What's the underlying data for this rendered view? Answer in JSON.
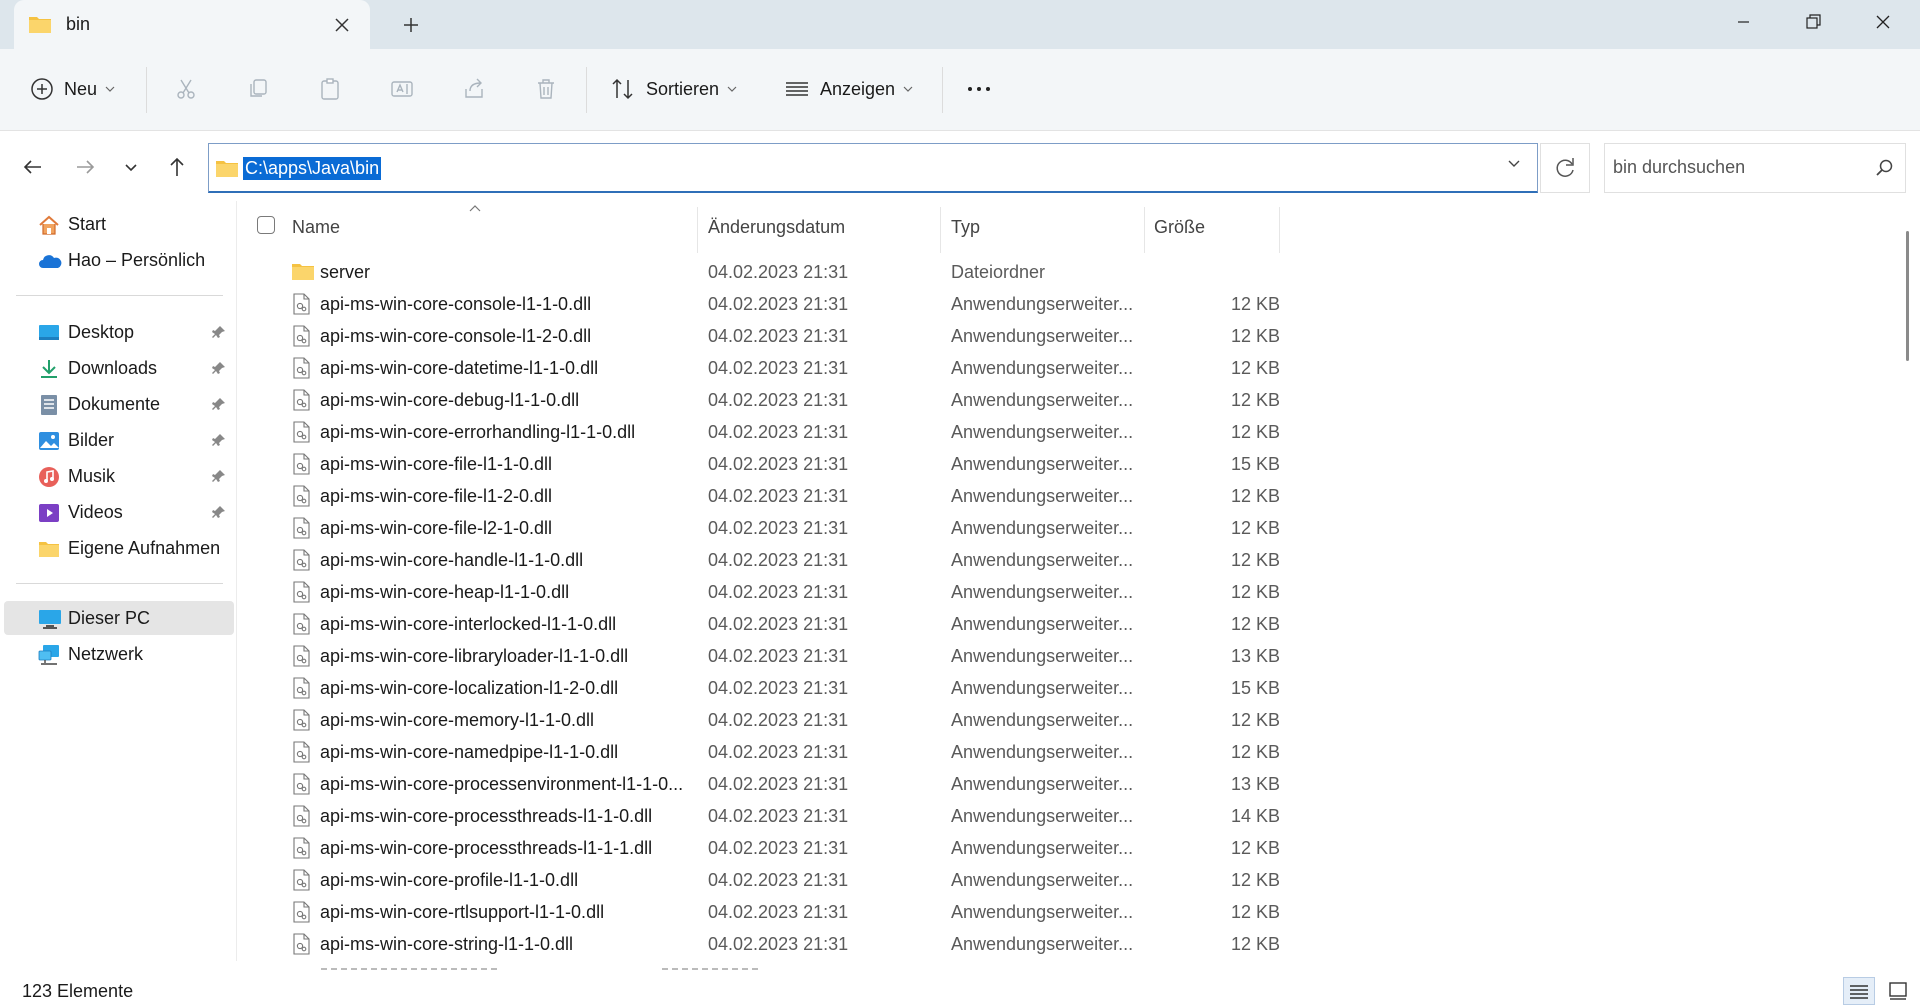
{
  "tab": {
    "title": "bin"
  },
  "toolbar": {
    "new_label": "Neu",
    "sort_label": "Sortieren",
    "view_label": "Anzeigen"
  },
  "address": {
    "path": "C:\\apps\\Java\\bin"
  },
  "search": {
    "placeholder": "bin durchsuchen"
  },
  "sidebar": {
    "top": [
      {
        "label": "Start",
        "icon": "home-icon"
      },
      {
        "label": "Hao – Persönlich",
        "icon": "onedrive-icon"
      }
    ],
    "quick": [
      {
        "label": "Desktop",
        "icon": "desktop-icon",
        "pinned": true
      },
      {
        "label": "Downloads",
        "icon": "downloads-icon",
        "pinned": true
      },
      {
        "label": "Dokumente",
        "icon": "documents-icon",
        "pinned": true
      },
      {
        "label": "Bilder",
        "icon": "pictures-icon",
        "pinned": true
      },
      {
        "label": "Musik",
        "icon": "music-icon",
        "pinned": true
      },
      {
        "label": "Videos",
        "icon": "videos-icon",
        "pinned": true
      },
      {
        "label": "Eigene Aufnahmen",
        "icon": "folder-icon",
        "pinned": false
      }
    ],
    "bottom": [
      {
        "label": "Dieser PC",
        "icon": "pc-icon",
        "selected": true
      },
      {
        "label": "Netzwerk",
        "icon": "network-icon"
      }
    ]
  },
  "columns": {
    "name": "Name",
    "date": "Änderungsdatum",
    "type": "Typ",
    "size": "Größe"
  },
  "files": [
    {
      "name": "server",
      "date": "04.02.2023 21:31",
      "type": "Dateiordner",
      "size": "",
      "kind": "folder"
    },
    {
      "name": "api-ms-win-core-console-l1-1-0.dll",
      "date": "04.02.2023 21:31",
      "type": "Anwendungserweiter...",
      "size": "12 KB",
      "kind": "dll"
    },
    {
      "name": "api-ms-win-core-console-l1-2-0.dll",
      "date": "04.02.2023 21:31",
      "type": "Anwendungserweiter...",
      "size": "12 KB",
      "kind": "dll"
    },
    {
      "name": "api-ms-win-core-datetime-l1-1-0.dll",
      "date": "04.02.2023 21:31",
      "type": "Anwendungserweiter...",
      "size": "12 KB",
      "kind": "dll"
    },
    {
      "name": "api-ms-win-core-debug-l1-1-0.dll",
      "date": "04.02.2023 21:31",
      "type": "Anwendungserweiter...",
      "size": "12 KB",
      "kind": "dll"
    },
    {
      "name": "api-ms-win-core-errorhandling-l1-1-0.dll",
      "date": "04.02.2023 21:31",
      "type": "Anwendungserweiter...",
      "size": "12 KB",
      "kind": "dll"
    },
    {
      "name": "api-ms-win-core-file-l1-1-0.dll",
      "date": "04.02.2023 21:31",
      "type": "Anwendungserweiter...",
      "size": "15 KB",
      "kind": "dll"
    },
    {
      "name": "api-ms-win-core-file-l1-2-0.dll",
      "date": "04.02.2023 21:31",
      "type": "Anwendungserweiter...",
      "size": "12 KB",
      "kind": "dll"
    },
    {
      "name": "api-ms-win-core-file-l2-1-0.dll",
      "date": "04.02.2023 21:31",
      "type": "Anwendungserweiter...",
      "size": "12 KB",
      "kind": "dll"
    },
    {
      "name": "api-ms-win-core-handle-l1-1-0.dll",
      "date": "04.02.2023 21:31",
      "type": "Anwendungserweiter...",
      "size": "12 KB",
      "kind": "dll"
    },
    {
      "name": "api-ms-win-core-heap-l1-1-0.dll",
      "date": "04.02.2023 21:31",
      "type": "Anwendungserweiter...",
      "size": "12 KB",
      "kind": "dll"
    },
    {
      "name": "api-ms-win-core-interlocked-l1-1-0.dll",
      "date": "04.02.2023 21:31",
      "type": "Anwendungserweiter...",
      "size": "12 KB",
      "kind": "dll"
    },
    {
      "name": "api-ms-win-core-libraryloader-l1-1-0.dll",
      "date": "04.02.2023 21:31",
      "type": "Anwendungserweiter...",
      "size": "13 KB",
      "kind": "dll"
    },
    {
      "name": "api-ms-win-core-localization-l1-2-0.dll",
      "date": "04.02.2023 21:31",
      "type": "Anwendungserweiter...",
      "size": "15 KB",
      "kind": "dll"
    },
    {
      "name": "api-ms-win-core-memory-l1-1-0.dll",
      "date": "04.02.2023 21:31",
      "type": "Anwendungserweiter...",
      "size": "12 KB",
      "kind": "dll"
    },
    {
      "name": "api-ms-win-core-namedpipe-l1-1-0.dll",
      "date": "04.02.2023 21:31",
      "type": "Anwendungserweiter...",
      "size": "12 KB",
      "kind": "dll"
    },
    {
      "name": "api-ms-win-core-processenvironment-l1-1-0...",
      "date": "04.02.2023 21:31",
      "type": "Anwendungserweiter...",
      "size": "13 KB",
      "kind": "dll"
    },
    {
      "name": "api-ms-win-core-processthreads-l1-1-0.dll",
      "date": "04.02.2023 21:31",
      "type": "Anwendungserweiter...",
      "size": "14 KB",
      "kind": "dll"
    },
    {
      "name": "api-ms-win-core-processthreads-l1-1-1.dll",
      "date": "04.02.2023 21:31",
      "type": "Anwendungserweiter...",
      "size": "12 KB",
      "kind": "dll"
    },
    {
      "name": "api-ms-win-core-profile-l1-1-0.dll",
      "date": "04.02.2023 21:31",
      "type": "Anwendungserweiter...",
      "size": "12 KB",
      "kind": "dll"
    },
    {
      "name": "api-ms-win-core-rtlsupport-l1-1-0.dll",
      "date": "04.02.2023 21:31",
      "type": "Anwendungserweiter...",
      "size": "12 KB",
      "kind": "dll"
    },
    {
      "name": "api-ms-win-core-string-l1-1-0.dll",
      "date": "04.02.2023 21:31",
      "type": "Anwendungserweiter...",
      "size": "12 KB",
      "kind": "dll"
    }
  ],
  "status": {
    "count": "123 Elemente"
  },
  "colors": {
    "accent": "#0a6bd5",
    "folder": "#f5c242",
    "titlebar": "#dde6ec",
    "selection": "#e5e5e5"
  }
}
